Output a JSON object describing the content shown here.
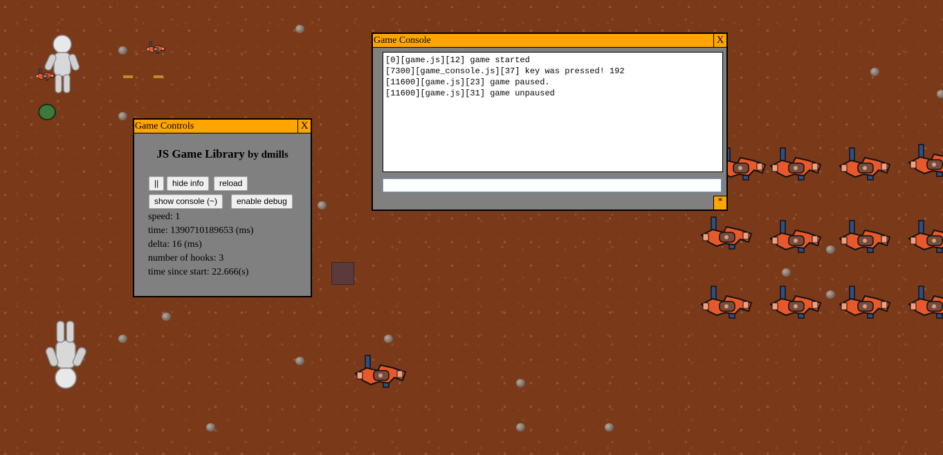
{
  "controls_panel": {
    "title": "Game Controls",
    "close_label": "X",
    "heading": "JS Game Library",
    "byline": "by dmills",
    "buttons": {
      "pause": "||",
      "hide_info": "hide info",
      "reload": "reload",
      "show_console": "show console (~)",
      "enable_debug": "enable debug"
    },
    "info": {
      "speed": "speed: 1",
      "time": "time: 1390710189653 (ms)",
      "delta": "delta: 16 (ms)",
      "hooks": "number of hooks: 3",
      "since_start": "time since start: 22.666(s)"
    }
  },
  "console_panel": {
    "title": "Game Console",
    "close_label": "X",
    "log": [
      "[0][game.js][12] game started",
      "[7300][game_console.js][37] key was pressed! 192",
      "[11600][game.js][23] game paused.",
      "[11600][game.js][31] game unpaused"
    ],
    "input_value": "",
    "resize_label": "*"
  },
  "colors": {
    "background": "#7a3a1a",
    "panel_titlebar": "#ffa500",
    "panel_body": "#808080",
    "ship_red": "#e8582a",
    "ship_blue": "#2c4f86"
  }
}
